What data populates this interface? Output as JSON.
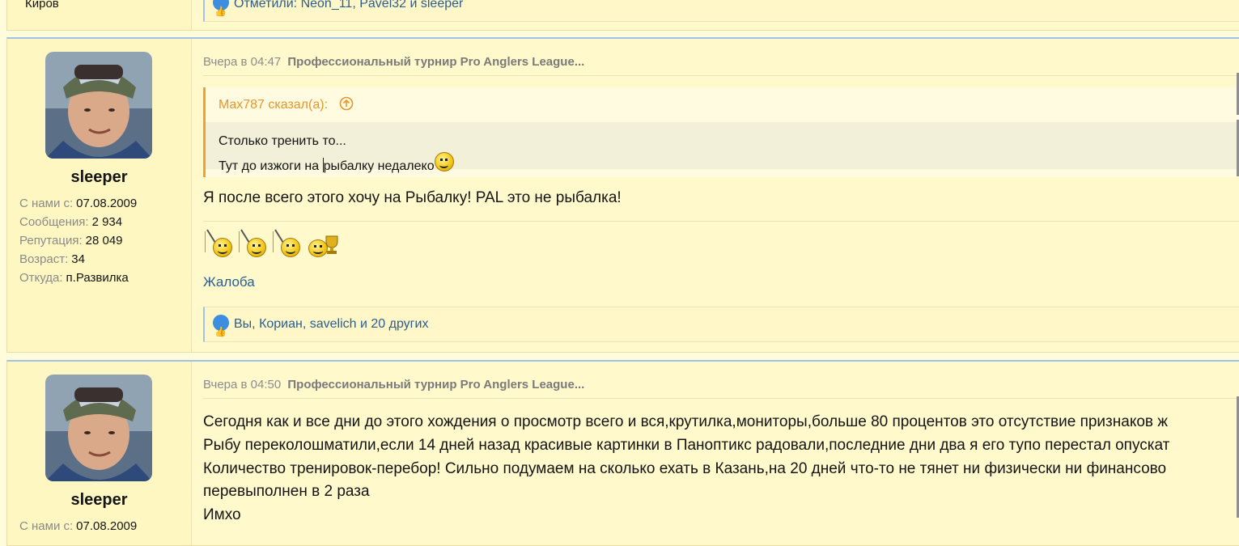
{
  "prev_post": {
    "location_value": "Киров",
    "likes_text": "Отметили: Neon_11, Pavel32 и sleeper"
  },
  "posts": [
    {
      "username": "sleeper",
      "stats": [
        {
          "k": "С нами с:",
          "v": "07.08.2009"
        },
        {
          "k": "Сообщения:",
          "v": "2 934"
        },
        {
          "k": "Репутация:",
          "v": "28 049"
        },
        {
          "k": "Возраст:",
          "v": "34"
        },
        {
          "k": "Откуда:",
          "v": "п.Развилка"
        }
      ],
      "time": "Вчера в 04:47",
      "thread": "Профессиональный турнир Pro Anglers League...",
      "quote": {
        "author": "Max787 сказал(а):",
        "line1": "Столько тренить то...",
        "line2_a": "Тут до изжоги на ",
        "line2_b": "рыбалку недалеко"
      },
      "message": "Я после всего этого хочу на Рыбалку! PAL это не рыбалка!",
      "report": "Жалоба",
      "likes": "Вы, Кориан, savelich и 20 других"
    },
    {
      "username": "sleeper",
      "stats": [
        {
          "k": "С нами с:",
          "v": "07.08.2009"
        }
      ],
      "time": "Вчера в 04:50",
      "thread": "Профессиональный турнир Pro Anglers League...",
      "lines": [
        "Сегодня как и все дни до этого хождения о просмотр всего и вся,крутилка,мониторы,больше 80 процентов это отсутствие признаков ж",
        "Рыбу переколошматили,если 14 дней назад красивые картинки в Паноптикс радовали,последние дни два я его тупо перестал опускат",
        "Количество тренировок-перебор! Сильно подумаем на сколько ехать в Казань,на 20 дней что-то не тянет ни физически ни финансово",
        "перевыполнен в 2 раза",
        "Имхо"
      ]
    }
  ],
  "colors": {
    "accent_link": "#2a5e8f",
    "quote_accent": "#f0a22e",
    "post_bg": "#fff9cc"
  }
}
